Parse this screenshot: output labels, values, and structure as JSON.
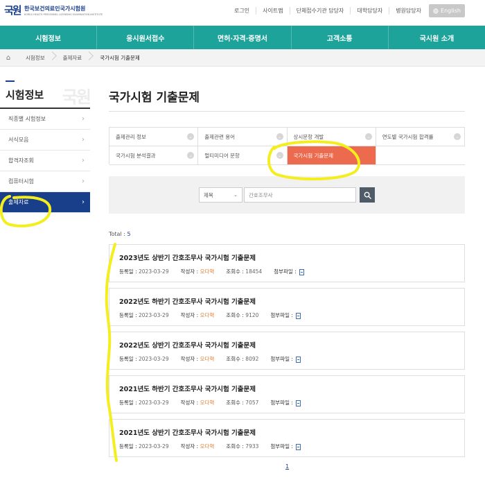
{
  "header": {
    "logo_mark": "국원",
    "logo_name": "한국보건의료인국가시험원",
    "logo_en": "KOREA HEALTH PERSONNEL LICENSING EXAMINATION INSTITUTE",
    "links": [
      "로그인",
      "사이트맵",
      "단체접수기관 담당자",
      "대학담당자",
      "병원담당자"
    ],
    "english": "English"
  },
  "gnb": [
    "시험정보",
    "응시원서접수",
    "면허·자격·증명서",
    "고객소통",
    "국시원 소개"
  ],
  "breadcrumb": [
    "시험정보",
    "출제자료",
    "국가시험 기출문제"
  ],
  "sidebar": {
    "title": "시험정보",
    "watermark": "국원",
    "items": [
      {
        "label": "직종별 시험정보"
      },
      {
        "label": "서식모음"
      },
      {
        "label": "합격자조회"
      },
      {
        "label": "컴퓨터시험"
      },
      {
        "label": "출제자료"
      }
    ]
  },
  "main": {
    "title": "국가시험 기출문제",
    "categories": [
      {
        "label": "출제관리 정보"
      },
      {
        "label": "출제관련 용어"
      },
      {
        "label": "상시문항 개발"
      },
      {
        "label": "연도별 국가시험 합격률"
      },
      {
        "label": "국가시험 분석결과"
      },
      {
        "label": "멀티미디어 문항"
      },
      {
        "label": "국가시험 기출문제"
      }
    ],
    "search": {
      "select": "제목",
      "query": "간호조무사"
    },
    "total_label": "Total : ",
    "total": "5",
    "meta_labels": {
      "date": "등록일 : ",
      "author": "작성자 : ",
      "views": "조회수 : ",
      "file": "첨부파일 : "
    },
    "rows": [
      {
        "title": "2023년도 상반기 간호조무사 국가시험 기출문제",
        "date": "2023-03-29",
        "author": "오다혁",
        "views": "18454"
      },
      {
        "title": "2022년도 하반기 간호조무사 국가시험 기출문제",
        "date": "2023-03-29",
        "author": "오다혁",
        "views": "9120"
      },
      {
        "title": "2022년도 상반기 간호조무사 국가시험 기출문제",
        "date": "2023-03-29",
        "author": "오다혁",
        "views": "8092"
      },
      {
        "title": "2021년도 하반기 간호조무사 국가시험 기출문제",
        "date": "2023-03-29",
        "author": "오다혁",
        "views": "7057"
      },
      {
        "title": "2021년도 상반기 간호조무사 국가시험 기출문제",
        "date": "2023-03-29",
        "author": "오다혁",
        "views": "7933"
      }
    ],
    "page": "1"
  },
  "colors": {
    "nav": "#1ea39b",
    "sidebar_active": "#1a3f8a",
    "category_active": "#ec6b4f",
    "highlight": "#f5ee1f"
  }
}
